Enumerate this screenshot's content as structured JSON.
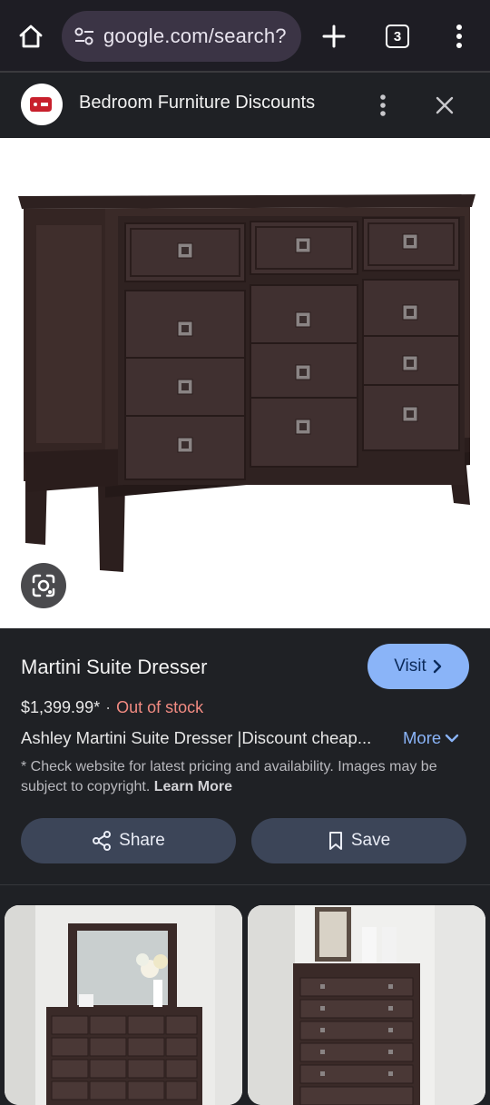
{
  "browser": {
    "url": "google.com/search?",
    "tab_count": "3"
  },
  "site": {
    "title": "Bedroom Furniture Discounts",
    "logo_color": "#c8202c"
  },
  "product": {
    "title": "Martini Suite Dresser",
    "visit_label": "Visit",
    "price": "$1,399.99*",
    "separator": "·",
    "stock": "Out of stock",
    "description": "Ashley Martini Suite Dresser |Discount cheap...",
    "more_label": "More",
    "disclaimer": "* Check website for latest pricing and availability. Images may be subject to copyright.",
    "learn_more": "Learn More",
    "share_label": "Share",
    "save_label": "Save"
  },
  "colors": {
    "accent": "#8ab4f8",
    "out_of_stock": "#f28b82",
    "button_bg": "#3c4558",
    "dresser": "#3a2a28"
  }
}
